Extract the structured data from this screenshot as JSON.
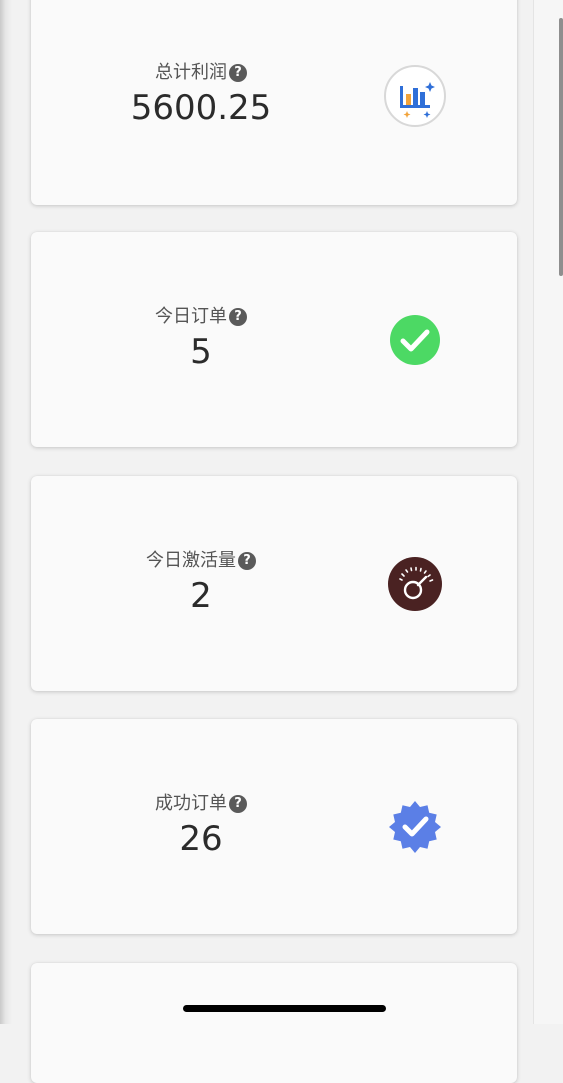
{
  "stats": [
    {
      "label": "总计利润",
      "value": "5600.25",
      "icon": "bar-chart-icon"
    },
    {
      "label": "今日订单",
      "value": "5",
      "icon": "check-circle-icon"
    },
    {
      "label": "今日激活量",
      "value": "2",
      "icon": "speedometer-icon"
    },
    {
      "label": "成功订单",
      "value": "26",
      "icon": "verified-badge-icon"
    }
  ],
  "help_glyph": "?",
  "colors": {
    "success_green": "#4cd964",
    "speedometer_brown": "#4a2222",
    "badge_blue": "#5b7fe6",
    "chart_blue": "#2f6fd8",
    "chart_orange": "#f2a33a"
  }
}
